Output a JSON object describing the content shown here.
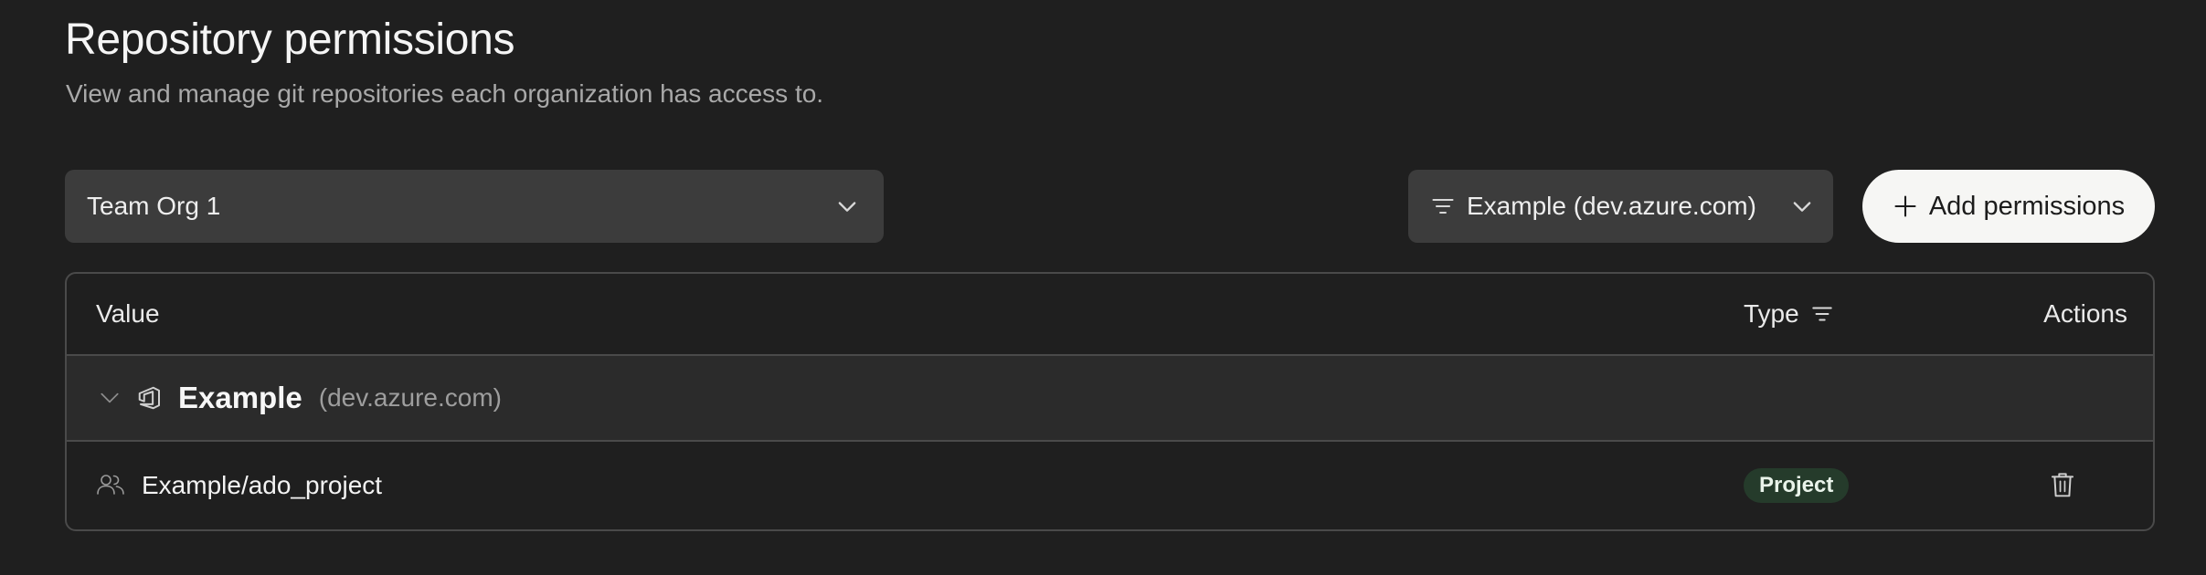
{
  "page": {
    "title": "Repository permissions",
    "subtitle": "View and manage git repositories each organization has access to."
  },
  "org_selector": {
    "value": "Team Org 1"
  },
  "filter_selector": {
    "value": "Example (dev.azure.com)"
  },
  "toolbar": {
    "add_label": "Add permissions"
  },
  "table": {
    "columns": {
      "value": "Value",
      "type": "Type",
      "actions": "Actions"
    },
    "groups": [
      {
        "name": "Example",
        "host": "(dev.azure.com)",
        "expanded": true,
        "rows": [
          {
            "value": "Example/ado_project",
            "type": "Project"
          }
        ]
      }
    ]
  },
  "icons": {
    "org_chevron": "chevron-down-icon",
    "filter": "filter-icon",
    "plus": "plus-icon",
    "type_filter": "filter-icon",
    "group_chevron": "chevron-down-icon",
    "azure": "azure-devops-icon",
    "members": "people-icon",
    "delete": "trash-icon"
  },
  "colors": {
    "background": "#1f1f1f",
    "surface": "#3c3c3c",
    "badge_bg": "#253b2b",
    "primary_button": "#f6f6f4"
  }
}
